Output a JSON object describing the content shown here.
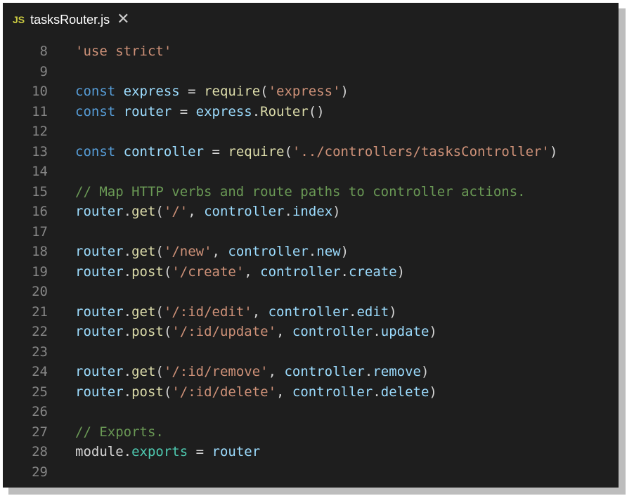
{
  "tab": {
    "badge": "JS",
    "title": "tasksRouter.js",
    "close": "✕"
  },
  "lines": [
    {
      "n": "8",
      "t": [
        [
          "str",
          "'use strict'"
        ]
      ]
    },
    {
      "n": "9",
      "t": []
    },
    {
      "n": "10",
      "t": [
        [
          "kw",
          "const"
        ],
        [
          "pun",
          " "
        ],
        [
          "var",
          "express"
        ],
        [
          "pun",
          " = "
        ],
        [
          "fn",
          "require"
        ],
        [
          "pun",
          "("
        ],
        [
          "str",
          "'express'"
        ],
        [
          "pun",
          ")"
        ]
      ]
    },
    {
      "n": "11",
      "t": [
        [
          "kw",
          "const"
        ],
        [
          "pun",
          " "
        ],
        [
          "var",
          "router"
        ],
        [
          "pun",
          " = "
        ],
        [
          "var",
          "express"
        ],
        [
          "pun",
          "."
        ],
        [
          "fn",
          "Router"
        ],
        [
          "pun",
          "()"
        ]
      ]
    },
    {
      "n": "12",
      "t": []
    },
    {
      "n": "13",
      "t": [
        [
          "kw",
          "const"
        ],
        [
          "pun",
          " "
        ],
        [
          "var",
          "controller"
        ],
        [
          "pun",
          " = "
        ],
        [
          "fn",
          "require"
        ],
        [
          "pun",
          "("
        ],
        [
          "str",
          "'../controllers/tasksController'"
        ],
        [
          "pun",
          ")"
        ]
      ]
    },
    {
      "n": "14",
      "t": []
    },
    {
      "n": "15",
      "t": [
        [
          "cmt",
          "// Map HTTP verbs and route paths to controller actions."
        ]
      ]
    },
    {
      "n": "16",
      "t": [
        [
          "var",
          "router"
        ],
        [
          "pun",
          "."
        ],
        [
          "fn",
          "get"
        ],
        [
          "pun",
          "("
        ],
        [
          "str",
          "'/'"
        ],
        [
          "pun",
          ", "
        ],
        [
          "var",
          "controller"
        ],
        [
          "pun",
          "."
        ],
        [
          "var",
          "index"
        ],
        [
          "pun",
          ")"
        ]
      ]
    },
    {
      "n": "17",
      "t": []
    },
    {
      "n": "18",
      "t": [
        [
          "var",
          "router"
        ],
        [
          "pun",
          "."
        ],
        [
          "fn",
          "get"
        ],
        [
          "pun",
          "("
        ],
        [
          "str",
          "'/new'"
        ],
        [
          "pun",
          ", "
        ],
        [
          "var",
          "controller"
        ],
        [
          "pun",
          "."
        ],
        [
          "var",
          "new"
        ],
        [
          "pun",
          ")"
        ]
      ]
    },
    {
      "n": "19",
      "t": [
        [
          "var",
          "router"
        ],
        [
          "pun",
          "."
        ],
        [
          "fn",
          "post"
        ],
        [
          "pun",
          "("
        ],
        [
          "str",
          "'/create'"
        ],
        [
          "pun",
          ", "
        ],
        [
          "var",
          "controller"
        ],
        [
          "pun",
          "."
        ],
        [
          "var",
          "create"
        ],
        [
          "pun",
          ")"
        ]
      ]
    },
    {
      "n": "20",
      "t": []
    },
    {
      "n": "21",
      "t": [
        [
          "var",
          "router"
        ],
        [
          "pun",
          "."
        ],
        [
          "fn",
          "get"
        ],
        [
          "pun",
          "("
        ],
        [
          "str",
          "'/:id/edit'"
        ],
        [
          "pun",
          ", "
        ],
        [
          "var",
          "controller"
        ],
        [
          "pun",
          "."
        ],
        [
          "var",
          "edit"
        ],
        [
          "pun",
          ")"
        ]
      ]
    },
    {
      "n": "22",
      "t": [
        [
          "var",
          "router"
        ],
        [
          "pun",
          "."
        ],
        [
          "fn",
          "post"
        ],
        [
          "pun",
          "("
        ],
        [
          "str",
          "'/:id/update'"
        ],
        [
          "pun",
          ", "
        ],
        [
          "var",
          "controller"
        ],
        [
          "pun",
          "."
        ],
        [
          "var",
          "update"
        ],
        [
          "pun",
          ")"
        ]
      ]
    },
    {
      "n": "23",
      "t": []
    },
    {
      "n": "24",
      "t": [
        [
          "var",
          "router"
        ],
        [
          "pun",
          "."
        ],
        [
          "fn",
          "get"
        ],
        [
          "pun",
          "("
        ],
        [
          "str",
          "'/:id/remove'"
        ],
        [
          "pun",
          ", "
        ],
        [
          "var",
          "controller"
        ],
        [
          "pun",
          "."
        ],
        [
          "var",
          "remove"
        ],
        [
          "pun",
          ")"
        ]
      ]
    },
    {
      "n": "25",
      "t": [
        [
          "var",
          "router"
        ],
        [
          "pun",
          "."
        ],
        [
          "fn",
          "post"
        ],
        [
          "pun",
          "("
        ],
        [
          "str",
          "'/:id/delete'"
        ],
        [
          "pun",
          ", "
        ],
        [
          "var",
          "controller"
        ],
        [
          "pun",
          "."
        ],
        [
          "var",
          "delete"
        ],
        [
          "pun",
          ")"
        ]
      ]
    },
    {
      "n": "26",
      "t": []
    },
    {
      "n": "27",
      "t": [
        [
          "cmt",
          "// Exports."
        ]
      ]
    },
    {
      "n": "28",
      "t": [
        [
          "pun",
          "module"
        ],
        [
          "pun",
          "."
        ],
        [
          "typ",
          "exports"
        ],
        [
          "pun",
          " = "
        ],
        [
          "var",
          "router"
        ]
      ]
    },
    {
      "n": "29",
      "t": []
    }
  ]
}
